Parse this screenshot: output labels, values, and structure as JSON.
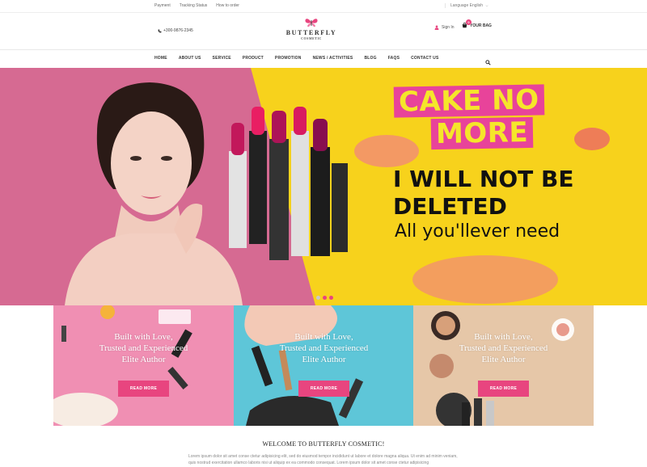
{
  "topbar": {
    "links": [
      "Payment",
      "Tracking Status",
      "How to order"
    ],
    "language": "Language English"
  },
  "header": {
    "phone": "+300-9876-2345",
    "logo_main": "BUTTERFLY",
    "logo_sub": "COSMETIC",
    "sign_in": "Sign In",
    "bag_label": "YOUR BAG",
    "bag_count": "0"
  },
  "nav": {
    "items": [
      "HOME",
      "ABOUT US",
      "SERVICE",
      "PRODUCT",
      "PROMOTION",
      "NEWS / ACTIVITIES",
      "BLOG",
      "FAQS",
      "CONTACT US"
    ]
  },
  "hero": {
    "title_line1": "CAKE NO",
    "title_line2": "MORE",
    "line2": "I WILL NOT BE",
    "line3": "DELETED",
    "line4": "All you'llever need"
  },
  "promos": [
    {
      "text_1": "Built with Love,",
      "text_2": "Trusted and Experienced",
      "text_3": "Elite Author",
      "button": "READ MORE"
    },
    {
      "text_1": "Built with Love,",
      "text_2": "Trusted and Experienced",
      "text_3": "Elite Author",
      "button": "READ MORE"
    },
    {
      "text_1": "Built with Love,",
      "text_2": "Trusted and Experienced",
      "text_3": "Elite Author",
      "button": "READ MORE"
    }
  ],
  "welcome": {
    "title": "WELCOME TO BUTTERFLY COSMETIC!",
    "body": "Lorem ipsum dolor sit amet conse ctetur adipisicing elit, sed do eiusmod tempor incididunt ut labore et dolore magna aliqua. Ut enim ad minim veniam, quis nostrud exercitation ullamco laboris nisi ut aliquip ex ea commodo consequat. Lorem ipsum dolor sit amet conse ctetur adipisicing"
  },
  "colors": {
    "accent": "#e8457f",
    "hero_pink": "#d66a92",
    "hero_yellow": "#f7d21c",
    "card_pink": "#f08fb3",
    "card_blue": "#5ec6d8",
    "card_beige": "#e6c7a8"
  }
}
